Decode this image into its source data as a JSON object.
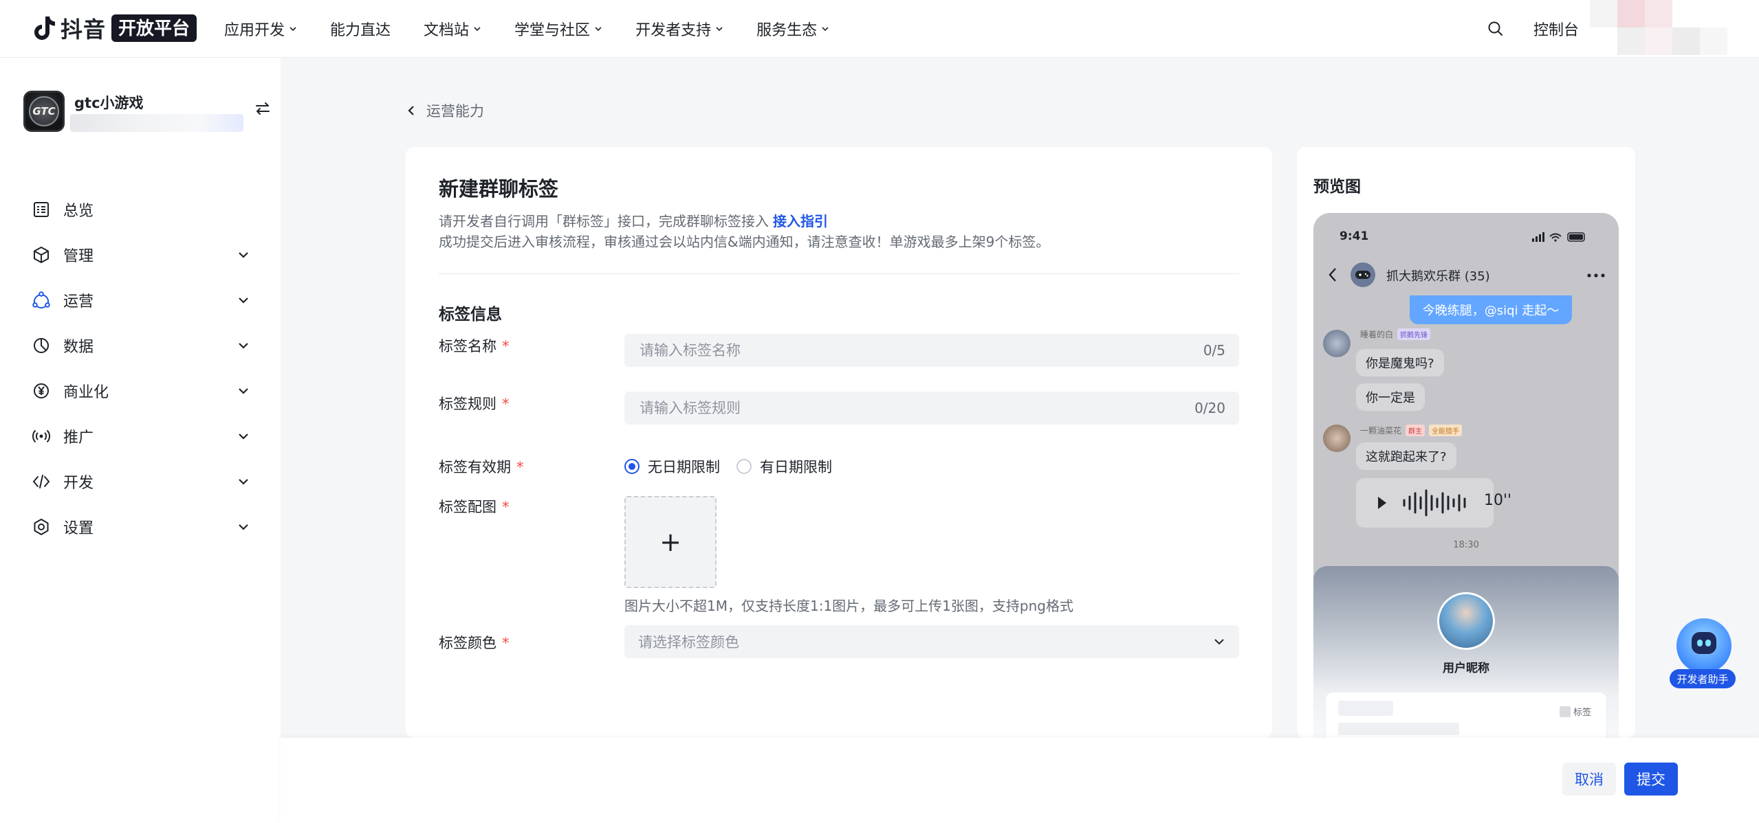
{
  "topbar": {
    "brand": "抖音",
    "brand_badge": "开放平台",
    "nav": [
      {
        "label": "应用开发",
        "has_dropdown": true
      },
      {
        "label": "能力直达",
        "has_dropdown": false
      },
      {
        "label": "文档站",
        "has_dropdown": true
      },
      {
        "label": "学堂与社区",
        "has_dropdown": true
      },
      {
        "label": "开发者支持",
        "has_dropdown": true
      },
      {
        "label": "服务生态",
        "has_dropdown": true
      }
    ],
    "search_icon": "search-icon",
    "console_label": "控制台"
  },
  "sidebar": {
    "app_name": "gtc小游戏",
    "app_avatar_text": "GTC",
    "switch_icon": "switch-icon",
    "menu": [
      {
        "label": "总览",
        "icon": "overview-icon",
        "active": false,
        "expandable": false
      },
      {
        "label": "管理",
        "icon": "cube-icon",
        "active": false,
        "expandable": true
      },
      {
        "label": "运营",
        "icon": "operation-icon",
        "active": true,
        "expandable": true
      },
      {
        "label": "数据",
        "icon": "pie-chart-icon",
        "active": false,
        "expandable": true
      },
      {
        "label": "商业化",
        "icon": "yen-icon",
        "active": false,
        "expandable": true
      },
      {
        "label": "推广",
        "icon": "broadcast-icon",
        "active": false,
        "expandable": true
      },
      {
        "label": "开发",
        "icon": "code-icon",
        "active": false,
        "expandable": true
      },
      {
        "label": "设置",
        "icon": "settings-icon",
        "active": false,
        "expandable": true
      }
    ]
  },
  "breadcrumb": {
    "label": "运营能力"
  },
  "form": {
    "title": "新建群聊标签",
    "desc_line1": "请开发者自行调用「群标签」接口，完成群聊标签接入",
    "desc_link": "接入指引",
    "desc_line2": "成功提交后进入审核流程，审核通过会以站内信&端内通知，请注意查收！单游戏最多上架9个标签。",
    "section_title": "标签信息",
    "name_field": {
      "label": "标签名称",
      "placeholder": "请输入标签名称",
      "value": "",
      "count": "0/5"
    },
    "rule_field": {
      "label": "标签规则",
      "placeholder": "请输入标签规则",
      "value": "",
      "count": "0/20"
    },
    "validity": {
      "label": "标签有效期",
      "options": [
        "无日期限制",
        "有日期限制"
      ],
      "selected": 0
    },
    "image": {
      "label": "标签配图",
      "plus": "+",
      "hint": "图片大小不超1M，仅支持长度1:1图片，最多可上传1张图，支持png格式"
    },
    "color": {
      "label": "标签颜色",
      "placeholder": "请选择标签颜色"
    },
    "required_mark": "*"
  },
  "preview": {
    "title": "预览图",
    "status_time": "9:41",
    "chat_title": "抓大鹅欢乐群 (35)",
    "my_message": "今晚练腿，@siqi 走起～",
    "user1": {
      "name": "睡着的白",
      "tag": "抓鹅先锋"
    },
    "msg1": "你是魔鬼吗?",
    "msg2": "你一定是",
    "user2": {
      "name": "一颗油菜花",
      "tag1": "群主",
      "tag2": "全能猎手"
    },
    "msg3": "这就跑起来了?",
    "voice_length": "10''",
    "chat_time": "18:30",
    "profile_name": "用户昵称",
    "profile_tag": "标签"
  },
  "footer": {
    "cancel": "取消",
    "submit": "提交"
  },
  "assistant": {
    "label": "开发者助手"
  },
  "colors": {
    "primary": "#1f56e6",
    "required": "#f54a45",
    "text": "#1f2329",
    "muted": "#646a73"
  }
}
